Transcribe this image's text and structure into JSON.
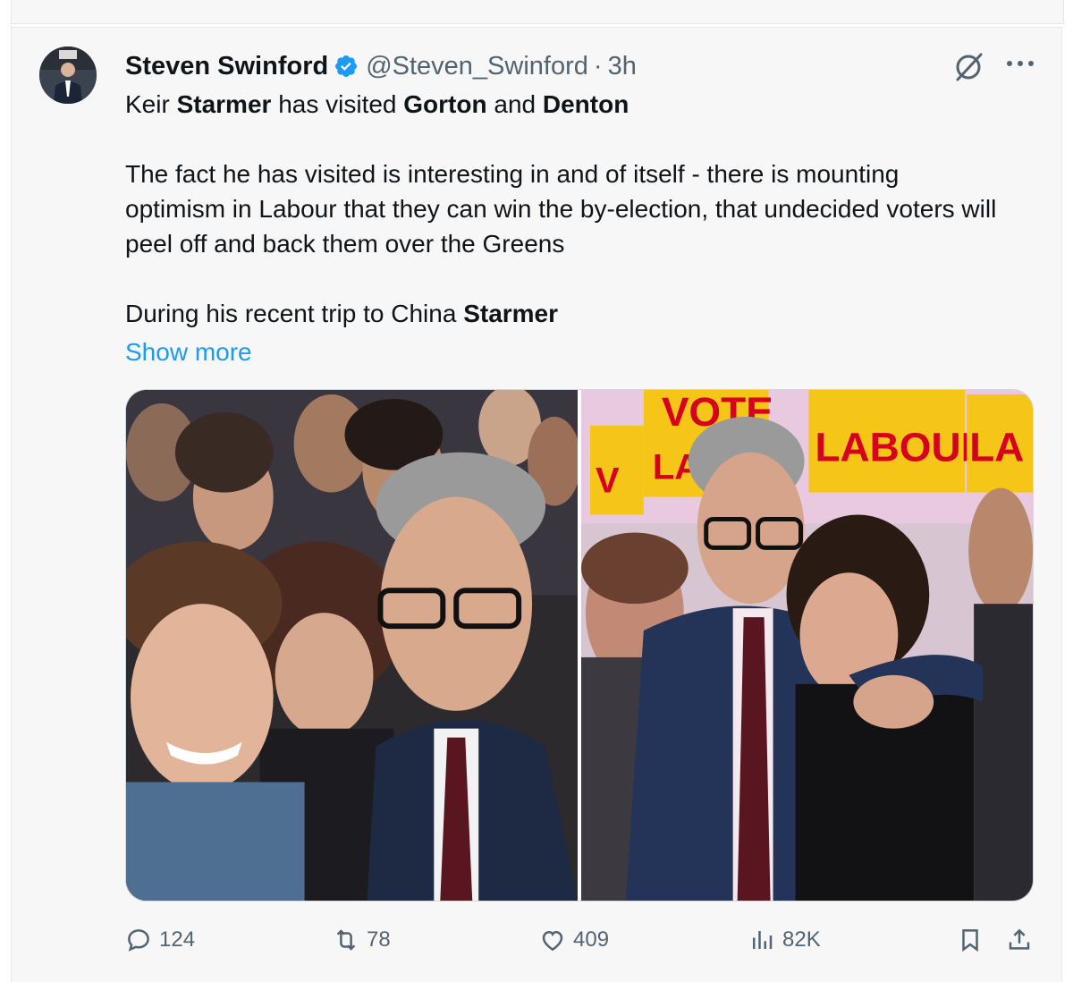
{
  "tweet": {
    "author_name": "Steven Swinford",
    "handle": "@Steven_Swinford",
    "separator": "·",
    "time": "3h",
    "line1": {
      "a": "Keir ",
      "b": "Starmer",
      "c": " has visited ",
      "d": "Gorton",
      "e": " and ",
      "f": "Denton"
    },
    "para2": "The fact he has visited is interesting in and of itself - there is mounting optimism in Labour that they can win the by-election, that undecided voters will peel off and back them over the Greens",
    "line3": {
      "a": "During his recent trip to China ",
      "b": "Starmer"
    },
    "show_more": "Show more",
    "sign_left_1": "VOTE",
    "sign_left_2": "LA",
    "sign_right_1": "LABOUI",
    "sign_right_2": "LA",
    "sign_small": "V"
  },
  "actions": {
    "replies": "124",
    "reposts": "78",
    "likes": "409",
    "views": "82K"
  },
  "colors": {
    "link": "#1d9bf0",
    "muted": "#536471",
    "verified": "#1d9bf0",
    "labour_yellow": "#f5c518",
    "labour_red": "#d6001c"
  },
  "icons": [
    "verified-badge-icon",
    "grok-icon",
    "more-icon",
    "reply-icon",
    "repost-icon",
    "like-icon",
    "views-icon",
    "bookmark-icon",
    "share-icon"
  ]
}
